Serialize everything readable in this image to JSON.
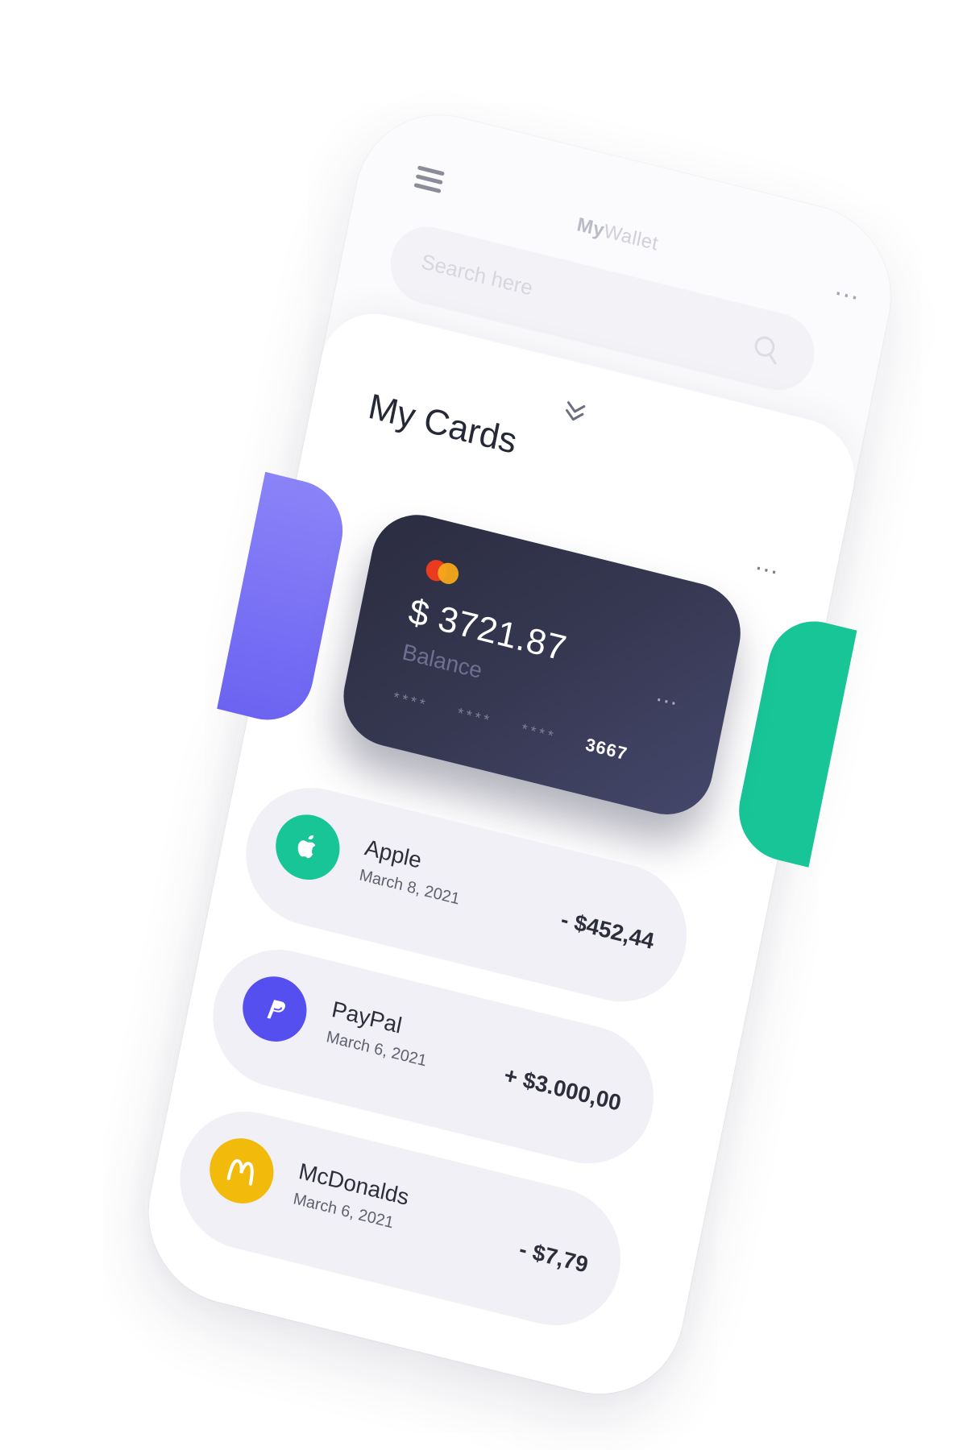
{
  "header": {
    "title_bold": "My",
    "title_light": "Wallet",
    "menu_icon": "hamburger-icon",
    "more_label": "..."
  },
  "search": {
    "placeholder": "Search here",
    "icon": "search-icon"
  },
  "cards_section": {
    "collapse_icon": "chevron-double-down-icon",
    "title": "My Cards",
    "more_label": "..."
  },
  "card": {
    "brand_icon": "mastercard-logo",
    "balance": "$ 3721.87",
    "balance_label": "Balance",
    "masked_groups": [
      "****",
      "****",
      "****"
    ],
    "last4": "3667",
    "more_label": "..."
  },
  "transactions": [
    {
      "name": "Apple",
      "date": "March 8, 2021",
      "amount": "- $452,44",
      "icon": "apple-icon",
      "icon_color": "#18c596"
    },
    {
      "name": "PayPal",
      "date": "March 6, 2021",
      "amount": "+ $3.000,00",
      "icon": "paypal-icon",
      "icon_color": "#554ff0"
    },
    {
      "name": "McDonalds",
      "date": "March 6, 2021",
      "amount": "- $7,79",
      "icon": "mcdonalds-icon",
      "icon_color": "#f2bb0c"
    }
  ],
  "colors": {
    "accent_purple": "#6c63f2",
    "accent_green": "#18c596",
    "card_dark": "#2b2c40",
    "mc_red": "#eb3b1f",
    "mc_orange": "#f7a81b"
  }
}
